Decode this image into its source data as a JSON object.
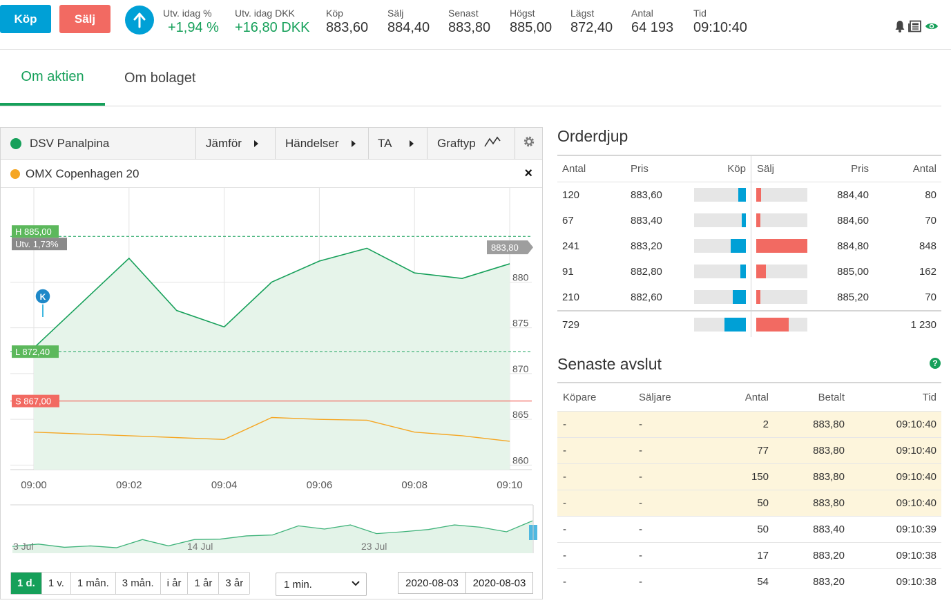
{
  "actions": {
    "buy_label": "Köp",
    "sell_label": "Sälj"
  },
  "stats": [
    {
      "label": "Utv. idag %",
      "value": "+1,94 %",
      "positive": true
    },
    {
      "label": "Utv. idag DKK",
      "value": "+16,80 DKK",
      "positive": true
    },
    {
      "label": "Köp",
      "value": "883,60"
    },
    {
      "label": "Sälj",
      "value": "884,40"
    },
    {
      "label": "Senast",
      "value": "883,80"
    },
    {
      "label": "Högst",
      "value": "885,00"
    },
    {
      "label": "Lägst",
      "value": "872,40"
    },
    {
      "label": "Antal",
      "value": "64 193"
    },
    {
      "label": "Tid",
      "value": "09:10:40"
    }
  ],
  "tabs": [
    {
      "label": "Om aktien",
      "active": true
    },
    {
      "label": "Om bolaget",
      "active": false
    }
  ],
  "chart_toolbar": {
    "instrument": "DSV Panalpina",
    "compare": "Jämför",
    "events": "Händelser",
    "ta": "TA",
    "chart_type": "Graftyp"
  },
  "compare_series": {
    "name": "OMX Copenhagen 20"
  },
  "chart_labels": {
    "high": "H 885,00",
    "change": "Utv. 1,73%",
    "low": "L 872,40",
    "sell": "S 867,00",
    "last": "883,80",
    "marker": "K"
  },
  "chart_data": {
    "type": "line",
    "x": [
      "09:00",
      "09:01",
      "09:02",
      "09:03",
      "09:04",
      "09:05",
      "09:06",
      "09:07",
      "09:08",
      "09:09",
      "09:10"
    ],
    "series": [
      {
        "name": "DSV Panalpina",
        "color": "#16a05a",
        "values": [
          872.8,
          877.7,
          882.6,
          876.9,
          875.1,
          880.0,
          882.3,
          883.7,
          881.0,
          880.4,
          882.0
        ]
      },
      {
        "name": "OMX Copenhagen 20",
        "color": "#f5a623",
        "values": [
          863.6,
          863.4,
          863.2,
          863.0,
          862.8,
          865.2,
          865.0,
          864.9,
          863.6,
          863.2,
          862.6
        ]
      }
    ],
    "xticks": [
      "09:00",
      "09:02",
      "09:04",
      "09:06",
      "09:08",
      "09:10"
    ],
    "yticks": [
      860,
      865,
      870,
      875,
      880
    ],
    "ylim": [
      859.5,
      890.3
    ],
    "high": 885.0,
    "low": 872.4,
    "sell_level": 867.0,
    "last": 883.8,
    "grid": true
  },
  "navigator": {
    "labels": [
      "3 Jul",
      "14 Jul",
      "23 Jul"
    ],
    "values": [
      0.15,
      0.2,
      0.13,
      0.16,
      0.12,
      0.3,
      0.16,
      0.3,
      0.31,
      0.38,
      0.4,
      0.6,
      0.53,
      0.62,
      0.43,
      0.47,
      0.52,
      0.62,
      0.57,
      0.47,
      0.71
    ]
  },
  "ranges": [
    {
      "label": "1 d.",
      "active": true
    },
    {
      "label": "1 v."
    },
    {
      "label": "1 mån."
    },
    {
      "label": "3 mån."
    },
    {
      "label": "i år"
    },
    {
      "label": "1 år"
    },
    {
      "label": "3 år"
    }
  ],
  "interval": "1 min.",
  "date_from": "2020-08-03",
  "date_to": "2020-08-03",
  "orderbook": {
    "title": "Orderdjup",
    "headers": {
      "qty": "Antal",
      "price": "Pris",
      "buy": "Köp",
      "sell": "Sälj",
      "sell_price": "Pris",
      "sell_qty": "Antal"
    },
    "rows": [
      {
        "buy_qty": "120",
        "buy_price": "883,60",
        "sell_price": "884,40",
        "sell_qty": "80",
        "buy_frac": 0.14,
        "sell_frac": 0.09
      },
      {
        "buy_qty": "67",
        "buy_price": "883,40",
        "sell_price": "884,60",
        "sell_qty": "70",
        "buy_frac": 0.08,
        "sell_frac": 0.08
      },
      {
        "buy_qty": "241",
        "buy_price": "883,20",
        "sell_price": "884,80",
        "sell_qty": "848",
        "buy_frac": 0.29,
        "sell_frac": 1.0
      },
      {
        "buy_qty": "91",
        "buy_price": "882,80",
        "sell_price": "885,00",
        "sell_qty": "162",
        "buy_frac": 0.11,
        "sell_frac": 0.19
      },
      {
        "buy_qty": "210",
        "buy_price": "882,60",
        "sell_price": "885,20",
        "sell_qty": "70",
        "buy_frac": 0.25,
        "sell_frac": 0.08
      }
    ],
    "total": {
      "buy_qty": "729",
      "sell_qty": "1 230",
      "buy_frac": 0.41,
      "sell_frac": 0.63
    }
  },
  "trades": {
    "title": "Senaste avslut",
    "headers": {
      "buyer": "Köpare",
      "seller": "Säljare",
      "qty": "Antal",
      "price": "Betalt",
      "time": "Tid"
    },
    "rows": [
      {
        "buyer": "-",
        "seller": "-",
        "qty": "2",
        "price": "883,80",
        "time": "09:10:40",
        "highlight": true
      },
      {
        "buyer": "-",
        "seller": "-",
        "qty": "77",
        "price": "883,80",
        "time": "09:10:40",
        "highlight": true
      },
      {
        "buyer": "-",
        "seller": "-",
        "qty": "150",
        "price": "883,80",
        "time": "09:10:40",
        "highlight": true
      },
      {
        "buyer": "-",
        "seller": "-",
        "qty": "50",
        "price": "883,80",
        "time": "09:10:40",
        "highlight": true
      },
      {
        "buyer": "-",
        "seller": "-",
        "qty": "50",
        "price": "883,40",
        "time": "09:10:39",
        "highlight": false
      },
      {
        "buyer": "-",
        "seller": "-",
        "qty": "17",
        "price": "883,20",
        "time": "09:10:38",
        "highlight": false
      },
      {
        "buyer": "-",
        "seller": "-",
        "qty": "54",
        "price": "883,20",
        "time": "09:10:38",
        "highlight": false
      }
    ]
  },
  "colors": {
    "green": "#16a05a",
    "blue": "#00a0d6",
    "red": "#f26a62",
    "orange": "#f5a623"
  }
}
